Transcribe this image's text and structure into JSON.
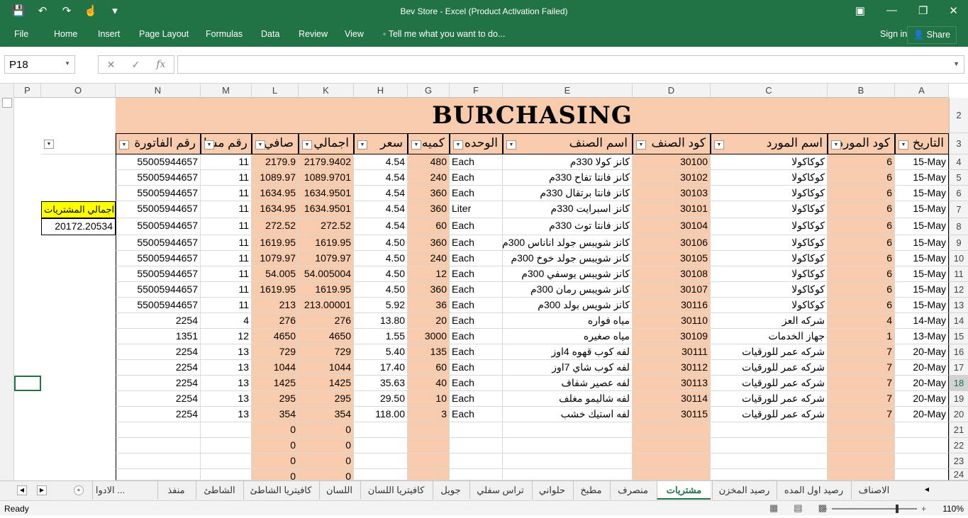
{
  "window": {
    "title": "Bev Store - Excel (Product Activation Failed)",
    "qat_icons": [
      "save-icon",
      "undo-icon",
      "redo-icon",
      "touch-mode-icon",
      "customize-icon"
    ],
    "controls": [
      "ribbon-display-icon",
      "minimize-icon",
      "restore-icon",
      "close-icon"
    ]
  },
  "menu": {
    "file": "File",
    "home": "Home",
    "insert": "Insert",
    "page_layout": "Page Layout",
    "formulas": "Formulas",
    "data": "Data",
    "review": "Review",
    "view": "View",
    "tell_me": "Tell me what you want to do...",
    "sign_in": "Sign in",
    "share": "Share"
  },
  "formula_bar": {
    "name_box": "P18",
    "fx": "fx",
    "formula": ""
  },
  "columns": [
    "P",
    "O",
    "N",
    "M",
    "L",
    "K",
    "H",
    "G",
    "F",
    "E",
    "D",
    "C",
    "B",
    "A"
  ],
  "banner": "BURCHASING",
  "headers": {
    "N": "رقم الفاتورة",
    "M": "رقم مسا",
    "L": "صافي",
    "K": "اجمالي",
    "H": "سعر",
    "G": "كميه",
    "F": "الوحده",
    "E": "اسم الصنف",
    "D": "كود الصنف",
    "C": "اسم المورد",
    "B": "كود المورد",
    "A": "التاريخ"
  },
  "total": {
    "label": "اجمالي المشتريات",
    "value": "20172.20534"
  },
  "rows": [
    {
      "r": "4",
      "N": "55005944657",
      "M": "11",
      "L": "2179.9",
      "K": "2179.9402",
      "H": "4.54",
      "G": "480",
      "F": "Each",
      "E": "كانز كولا 330م",
      "D": "30100",
      "C": "كوكاكولا",
      "B": "6",
      "A": "15-May"
    },
    {
      "r": "5",
      "N": "55005944657",
      "M": "11",
      "L": "1089.97",
      "K": "1089.9701",
      "H": "4.54",
      "G": "240",
      "F": "Each",
      "E": "كانز فانتا تفاح 330م",
      "D": "30102",
      "C": "كوكاكولا",
      "B": "6",
      "A": "15-May"
    },
    {
      "r": "6",
      "N": "55005944657",
      "M": "11",
      "L": "1634.95",
      "K": "1634.9501",
      "H": "4.54",
      "G": "360",
      "F": "Each",
      "E": "كانز فانتا برتقال 330م",
      "D": "30103",
      "C": "كوكاكولا",
      "B": "6",
      "A": "15-May"
    },
    {
      "r": "7",
      "N": "55005944657",
      "M": "11",
      "L": "1634.95",
      "K": "1634.9501",
      "H": "4.54",
      "G": "360",
      "F": "Liter",
      "E": "كانز اسبرايت 330م",
      "D": "30101",
      "C": "كوكاكولا",
      "B": "6",
      "A": "15-May"
    },
    {
      "r": "8",
      "N": "55005944657",
      "M": "11",
      "L": "272.52",
      "K": "272.52",
      "H": "4.54",
      "G": "60",
      "F": "Each",
      "E": "كانز فانتا توث 330م",
      "D": "30104",
      "C": "كوكاكولا",
      "B": "6",
      "A": "15-May"
    },
    {
      "r": "9",
      "N": "55005944657",
      "M": "11",
      "L": "1619.95",
      "K": "1619.95",
      "H": "4.50",
      "G": "360",
      "F": "Each",
      "E": "كانز شويبس جولد اناناس 300م",
      "D": "30106",
      "C": "كوكاكولا",
      "B": "6",
      "A": "15-May"
    },
    {
      "r": "10",
      "N": "55005944657",
      "M": "11",
      "L": "1079.97",
      "K": "1079.97",
      "H": "4.50",
      "G": "240",
      "F": "Each",
      "E": "كانز شويبس جولد خوخ 300م",
      "D": "30105",
      "C": "كوكاكولا",
      "B": "6",
      "A": "15-May"
    },
    {
      "r": "11",
      "N": "55005944657",
      "M": "11",
      "L": "54.005",
      "K": "54.005004",
      "H": "4.50",
      "G": "12",
      "F": "Each",
      "E": "كانز شويبس يوسفي 300م",
      "D": "30108",
      "C": "كوكاكولا",
      "B": "6",
      "A": "15-May"
    },
    {
      "r": "12",
      "N": "55005944657",
      "M": "11",
      "L": "1619.95",
      "K": "1619.95",
      "H": "4.50",
      "G": "360",
      "F": "Each",
      "E": "كانز شويبس رمان 300م",
      "D": "30107",
      "C": "كوكاكولا",
      "B": "6",
      "A": "15-May"
    },
    {
      "r": "13",
      "N": "55005944657",
      "M": "11",
      "L": "213",
      "K": "213.00001",
      "H": "5.92",
      "G": "36",
      "F": "Each",
      "E": "كانز شويس بولد 300م",
      "D": "30116",
      "C": "كوكاكولا",
      "B": "6",
      "A": "15-May"
    },
    {
      "r": "14",
      "N": "2254",
      "M": "4",
      "L": "276",
      "K": "276",
      "H": "13.80",
      "G": "20",
      "F": "Each",
      "E": "مياه فواره",
      "D": "30110",
      "C": "شركه العز",
      "B": "4",
      "A": "14-May"
    },
    {
      "r": "15",
      "N": "1351",
      "M": "12",
      "L": "4650",
      "K": "4650",
      "H": "1.55",
      "G": "3000",
      "F": "Each",
      "E": "مياه صغيره",
      "D": "30109",
      "C": "جهاز الخدمات",
      "B": "1",
      "A": "13-May"
    },
    {
      "r": "16",
      "N": "2254",
      "M": "13",
      "L": "729",
      "K": "729",
      "H": "5.40",
      "G": "135",
      "F": "Each",
      "E": "لفه كوب قهوه 4اوز",
      "D": "30111",
      "C": "شركه عمر للورقيات",
      "B": "7",
      "A": "20-May"
    },
    {
      "r": "17",
      "N": "2254",
      "M": "13",
      "L": "1044",
      "K": "1044",
      "H": "17.40",
      "G": "60",
      "F": "Each",
      "E": "لفه كوب شاي 7اوز",
      "D": "30112",
      "C": "شركه عمر للورقيات",
      "B": "7",
      "A": "20-May"
    },
    {
      "r": "18",
      "N": "2254",
      "M": "13",
      "L": "1425",
      "K": "1425",
      "H": "35.63",
      "G": "40",
      "F": "Each",
      "E": "لفه عصير شفاف",
      "D": "30113",
      "C": "شركه عمر للورقيات",
      "B": "7",
      "A": "20-May"
    },
    {
      "r": "19",
      "N": "2254",
      "M": "13",
      "L": "295",
      "K": "295",
      "H": "29.50",
      "G": "10",
      "F": "Each",
      "E": "لفه شاليمو مغلف",
      "D": "30114",
      "C": "شركه عمر للورقيات",
      "B": "7",
      "A": "20-May"
    },
    {
      "r": "20",
      "N": "2254",
      "M": "13",
      "L": "354",
      "K": "354",
      "H": "118.00",
      "G": "3",
      "F": "Each",
      "E": "لفه استيك خشب",
      "D": "30115",
      "C": "شركه عمر للورقيات",
      "B": "7",
      "A": "20-May"
    },
    {
      "r": "21",
      "N": "",
      "M": "",
      "L": "0",
      "K": "0",
      "H": "",
      "G": "",
      "F": "",
      "E": "",
      "D": "",
      "C": "",
      "B": "",
      "A": ""
    },
    {
      "r": "22",
      "N": "",
      "M": "",
      "L": "0",
      "K": "0",
      "H": "",
      "G": "",
      "F": "",
      "E": "",
      "D": "",
      "C": "",
      "B": "",
      "A": ""
    },
    {
      "r": "23",
      "N": "",
      "M": "",
      "L": "0",
      "K": "0",
      "H": "",
      "G": "",
      "F": "",
      "E": "",
      "D": "",
      "C": "",
      "B": "",
      "A": ""
    },
    {
      "r": "24",
      "N": "",
      "M": "",
      "L": "0",
      "K": "0",
      "H": "",
      "G": "",
      "F": "",
      "E": "",
      "D": "",
      "C": "",
      "B": "",
      "A": ""
    }
  ],
  "tabs": [
    "الاصناف",
    "رصيد اول المده",
    "رصيد المخزن",
    "مشتريات",
    "منصرف",
    "مطبخ",
    "حلواني",
    "تراس سفلي",
    "جويل",
    "كافيتريا اللسان",
    "اللسان",
    "كافيتريا الشاطئ",
    "الشاطئ",
    "منفذ لوران",
    "الادوا ..."
  ],
  "active_tab": "مشتريات",
  "status": {
    "ready": "Ready",
    "zoom": "110%"
  }
}
